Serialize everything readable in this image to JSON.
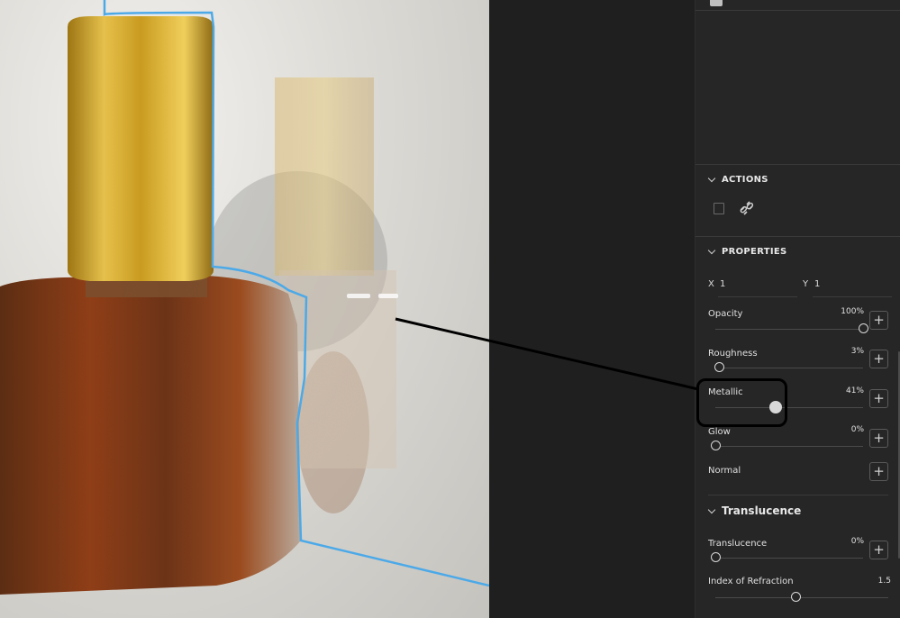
{
  "panel": {
    "actions": {
      "title": "ACTIONS",
      "icons": [
        "replace-icon",
        "unlink-icon"
      ]
    },
    "properties": {
      "title": "PROPERTIES",
      "repeat": {
        "x_label": "X",
        "x_value": "1",
        "y_label": "Y",
        "y_value": "1"
      },
      "sliders": [
        {
          "label": "Opacity",
          "value_text": "100%",
          "value": 100
        },
        {
          "label": "Roughness",
          "value_text": "3%",
          "value": 3
        },
        {
          "label": "Metallic",
          "value_text": "41%",
          "value": 41
        },
        {
          "label": "Glow",
          "value_text": "0%",
          "value": 0
        }
      ],
      "normal_label": "Normal"
    },
    "translucence": {
      "title": "Translucence",
      "translucence": {
        "label": "Translucence",
        "value_text": "0%",
        "value": 0
      },
      "ior": {
        "label": "Index of Refraction",
        "value_text": "1.5",
        "value": 1.5
      }
    }
  },
  "colors": {
    "selection_outline": "#4aa8e8",
    "panel_bg": "#262626",
    "gold": "#c9a227",
    "amber": "#8a3a12"
  }
}
